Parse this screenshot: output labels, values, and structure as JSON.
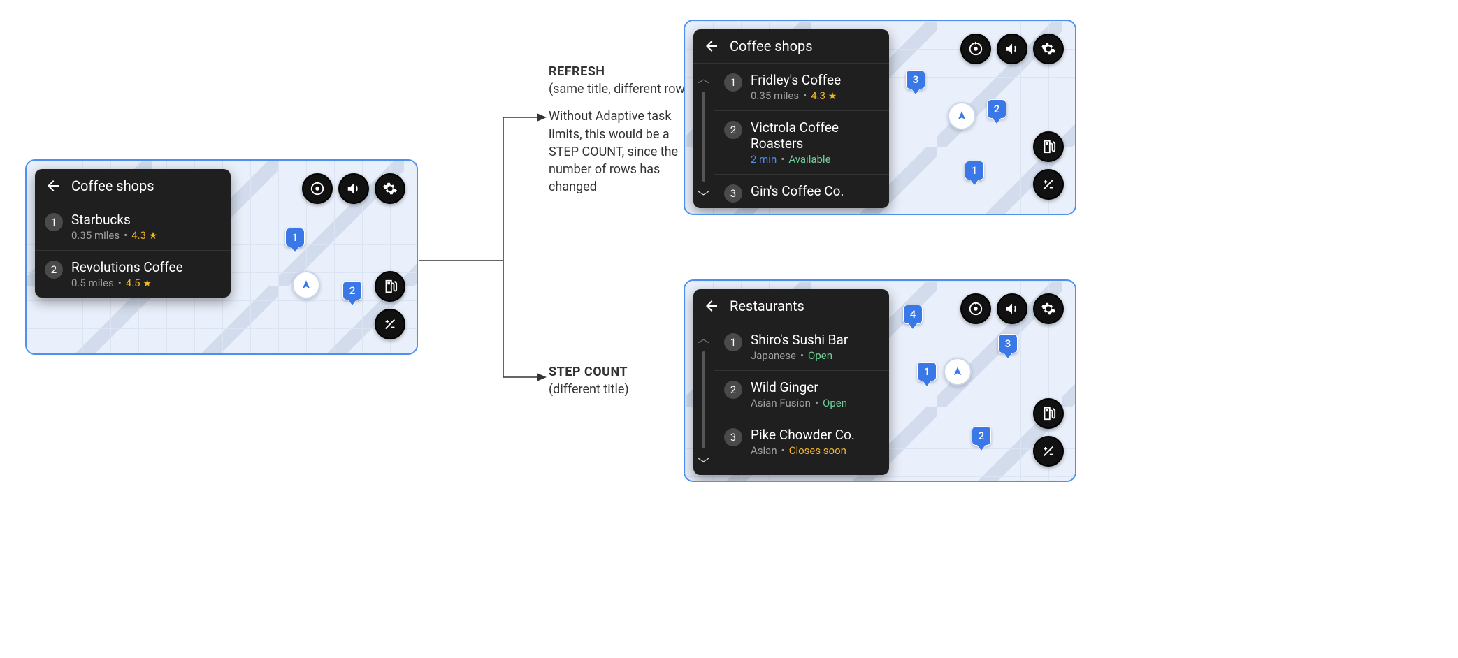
{
  "colors": {
    "accent": "#3b78e7",
    "dark": "#1f1f1f",
    "green": "#6fcf97",
    "orange": "#f2b427"
  },
  "annotations": {
    "refresh": {
      "heading": "REFRESH",
      "sub": "(same title, different rows)",
      "body": "Without Adaptive task limits, this would be a STEP COUNT, since the number of rows has changed"
    },
    "step_count": {
      "heading": "STEP COUNT",
      "sub": "(different title)"
    }
  },
  "frame_left": {
    "title": "Coffee shops",
    "items": [
      {
        "num": "1",
        "title": "Starbucks",
        "distance": "0.35 miles",
        "rating": "4.3"
      },
      {
        "num": "2",
        "title": "Revolutions Coffee",
        "distance": "0.5 miles",
        "rating": "4.5"
      }
    ],
    "pins": {
      "p1": "1",
      "p2": "2"
    }
  },
  "frame_top_right": {
    "title": "Coffee shops",
    "items": [
      {
        "num": "1",
        "title": "Fridley's Coffee",
        "distance": "0.35 miles",
        "rating": "4.3"
      },
      {
        "num": "2",
        "title": "Victrola Coffee Roasters",
        "time": "2 min",
        "status": "Available"
      },
      {
        "num": "3",
        "title": "Gin's Coffee Co."
      }
    ],
    "pins": {
      "p1": "1",
      "p2": "2",
      "p3": "3"
    }
  },
  "frame_bottom_right": {
    "title": "Restaurants",
    "items": [
      {
        "num": "1",
        "title": "Shiro's Sushi Bar",
        "cuisine": "Japanese",
        "status": "Open"
      },
      {
        "num": "2",
        "title": "Wild Ginger",
        "cuisine": "Asian Fusion",
        "status": "Open"
      },
      {
        "num": "3",
        "title": "Pike Chowder Co.",
        "cuisine": "Asian",
        "status": "Closes soon"
      }
    ],
    "pins": {
      "p1": "1",
      "p2": "2",
      "p3": "3",
      "p4": "4"
    }
  }
}
